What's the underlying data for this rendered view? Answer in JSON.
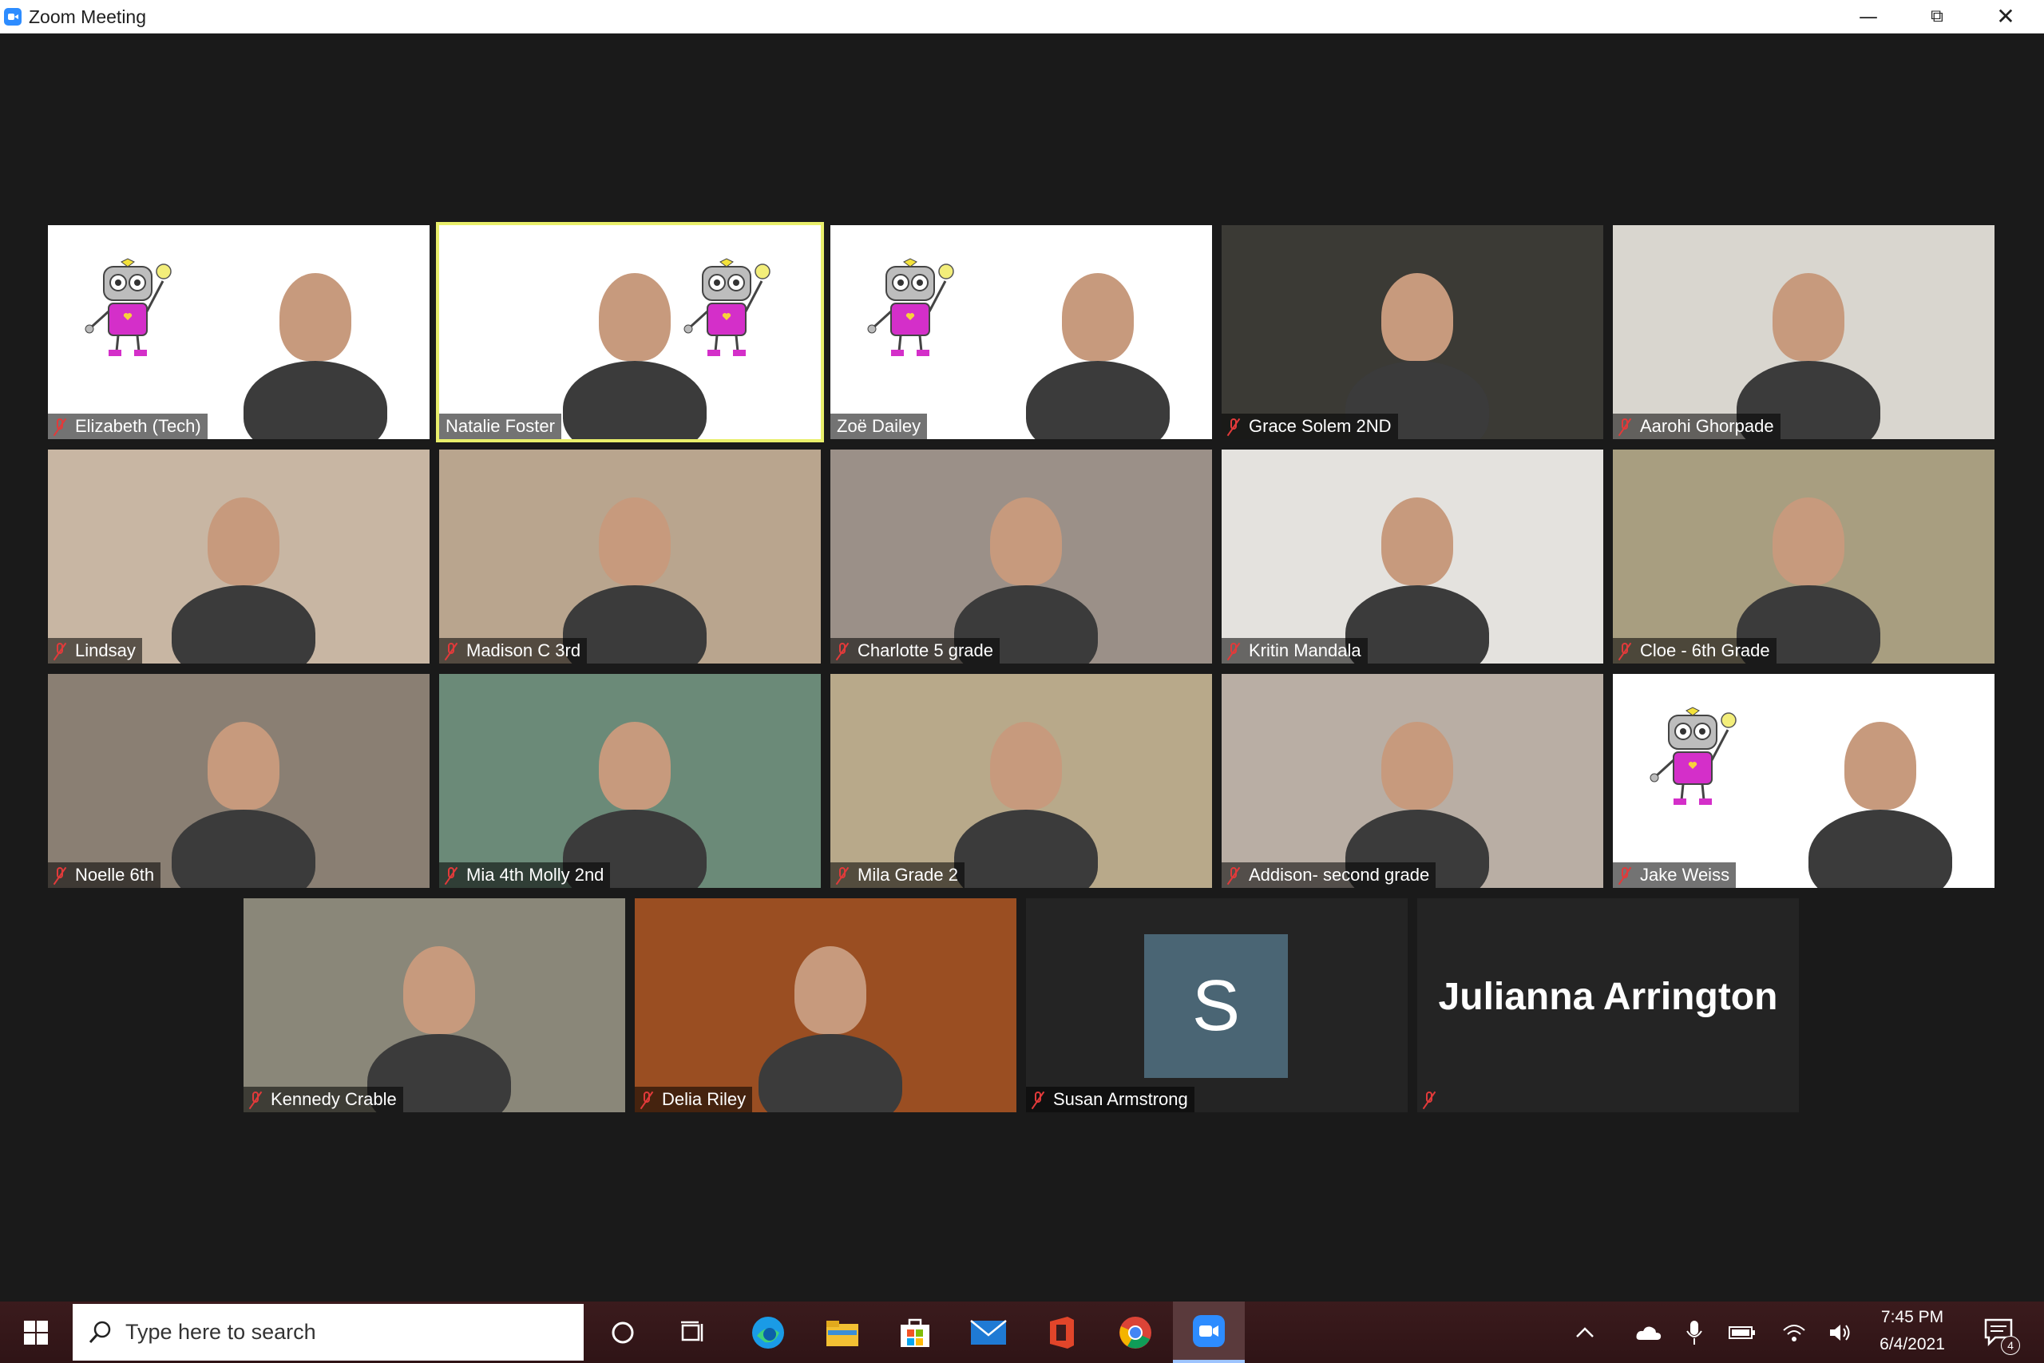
{
  "window": {
    "title": "Zoom Meeting",
    "controls": [
      "minimize",
      "restore",
      "close"
    ]
  },
  "participants": [
    {
      "name": "Elizabeth (Tech)",
      "muted": true,
      "bg": "#ffffff",
      "logo": true
    },
    {
      "name": "Natalie Foster",
      "muted": false,
      "bg": "#ffffff",
      "logo": true,
      "active_speaker": true
    },
    {
      "name": "Zoë Dailey",
      "muted": false,
      "bg": "#ffffff",
      "logo": true
    },
    {
      "name": "Grace Solem 2ND",
      "muted": true,
      "bg": "#3b3a35"
    },
    {
      "name": "Aarohi Ghorpade",
      "muted": true,
      "bg": "#d9d6cf"
    },
    {
      "name": "Lindsay",
      "muted": true,
      "bg": "#c8b6a3"
    },
    {
      "name": "Madison C 3rd",
      "muted": true,
      "bg": "#b9a58e"
    },
    {
      "name": "Charlotte 5 grade",
      "muted": true,
      "bg": "#9b9088"
    },
    {
      "name": "Kritin Mandala",
      "muted": true,
      "bg": "#e4e2de"
    },
    {
      "name": "Cloe - 6th Grade",
      "muted": true,
      "bg": "#a89e80"
    },
    {
      "name": "Noelle 6th",
      "muted": true,
      "bg": "#8a7f73"
    },
    {
      "name": "Mia 4th Molly 2nd",
      "muted": true,
      "bg": "#6b8a78"
    },
    {
      "name": "Mila Grade 2",
      "muted": true,
      "bg": "#b8a98a"
    },
    {
      "name": "Addison- second grade",
      "muted": true,
      "bg": "#b9aea4"
    },
    {
      "name": "Jake Weiss",
      "muted": true,
      "bg": "#ffffff",
      "logo": true
    },
    {
      "name": "Kennedy Crable",
      "muted": true,
      "bg": "#8a8779"
    },
    {
      "name": "Delia Riley",
      "muted": true,
      "bg": "#9a4e22"
    },
    {
      "name": "Susan Armstrong",
      "muted": true,
      "bg": "#242424",
      "avatar_letter": "S"
    },
    {
      "name": "Julianna Arrington",
      "muted": true,
      "bg": "#242424",
      "name_only": true
    }
  ],
  "taskbar": {
    "search_placeholder": "Type here to search",
    "apps": [
      "cortana-icon",
      "task-view-icon",
      "edge-icon",
      "file-explorer-icon",
      "store-icon",
      "mail-icon",
      "office-icon",
      "chrome-icon",
      "zoom-icon"
    ],
    "time": "7:45 PM",
    "date": "6/4/2021",
    "notification_count": "4"
  },
  "colors": {
    "active_speaker": "#e9ef6b",
    "muted_mic": "#e23a3a",
    "zoom_blue": "#2d8cff"
  }
}
